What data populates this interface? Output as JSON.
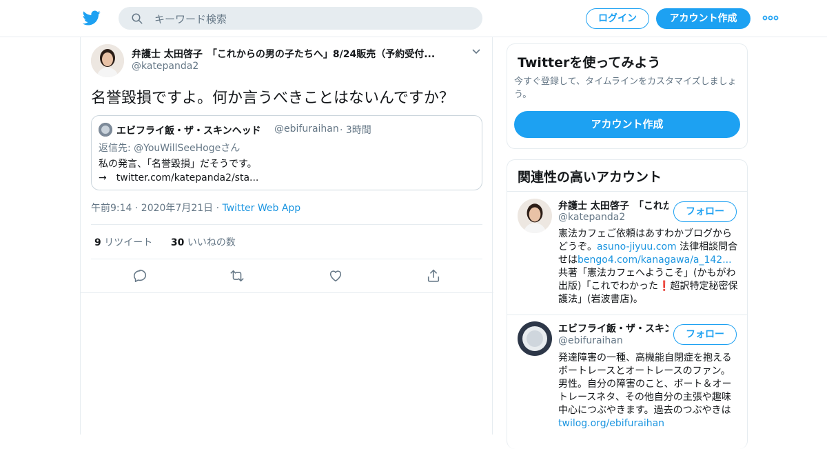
{
  "header": {
    "logo_icon": "twitter-bird-icon",
    "search_placeholder": "キーワード検索",
    "login_label": "ログイン",
    "signup_label": "アカウント作成",
    "more_icon": "more-dots-icon",
    "brand_color": "#1da1f2"
  },
  "tweet": {
    "author_name": "弁護士 太田啓子　「これからの男の子たちへ」8/24販売（予約受付...",
    "author_handle": "@katepanda2",
    "text": "名誉毀損ですよ。何か言うべきことはないんですか？",
    "quote": {
      "name": "エビフライ飯・ザ・スキンヘッド",
      "handle": "@ebifuraihan",
      "time": "· 3時間",
      "reply_to": "返信先: @YouWillSeeHogeさん",
      "line1": "私の発言、「名誉毀損」だそうです。",
      "line2": "→　twitter.com/katepanda2/sta..."
    },
    "time": "午前9:14 · 2020年7月21日 · ",
    "via": "Twitter Web App",
    "retweet_count": "9",
    "retweet_label": "リツイート",
    "like_count": "30",
    "like_label": "いいねの数"
  },
  "sidebar": {
    "signup_card": {
      "title": "Twitterを使ってみよう",
      "desc": "今すぐ登録して、タイムラインをカスタマイズしましょう。",
      "cta": "アカウント作成"
    },
    "related": {
      "title": "関連性の高いアカウント",
      "follow_label": "フォロー",
      "accounts": [
        {
          "name": "弁護士 太田啓子　「これからの...",
          "handle": "@katepanda2",
          "bio_a": "憲法カフェご依頼はあすわかブログからどうぞ。",
          "link1": "asuno-jiyuu.com",
          "bio_b": " 法律相談問合せは",
          "link2": "bengo4.com/kanagawa/a_142...",
          "bio_c": " 共著「憲法カフェへようこそ」(かもがわ出版)「これでわかった❗超訳特定秘密保護法」(岩波書店)。"
        },
        {
          "name": "エビフライ飯・ザ・スキンヘッド",
          "handle": "@ebifuraihan",
          "bio_a": "発達障害の一種、高機能自閉症を抱えるボートレースとオートレースのファン。男性。自分の障害のこと、ボート＆オートレースネタ、その他自分の主張や趣味中心につぶやきます。過去のつぶやきは　",
          "link1": "twilog.org/ebifuraihan"
        }
      ]
    }
  }
}
